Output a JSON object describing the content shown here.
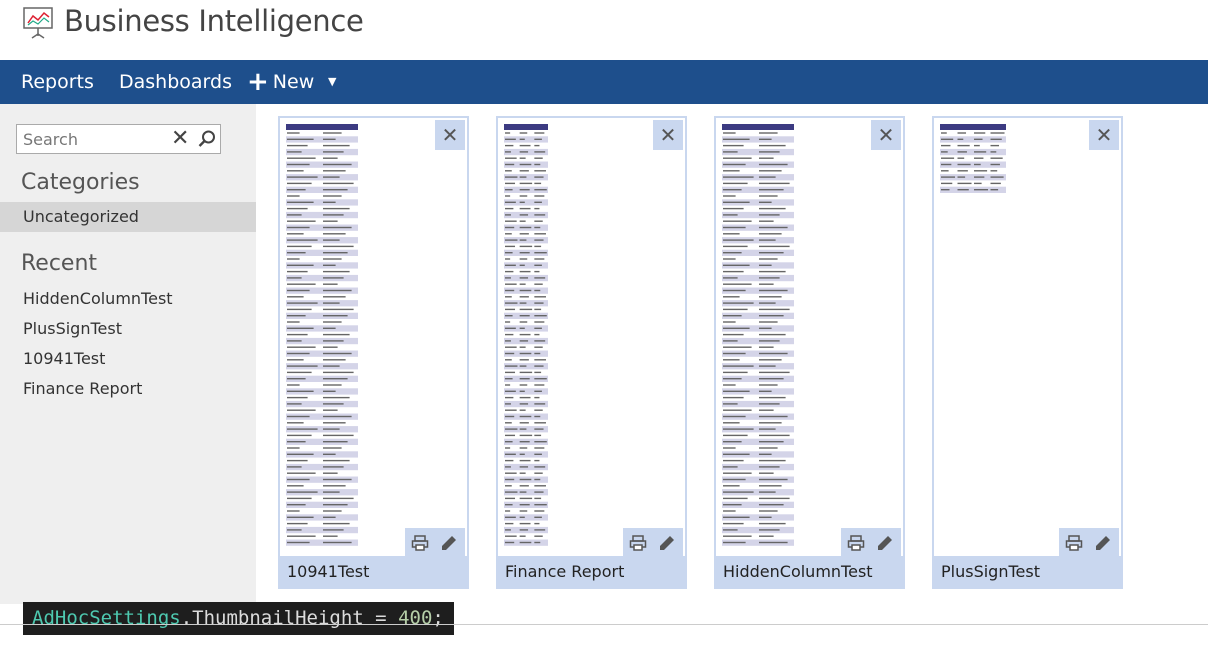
{
  "app": {
    "title": "Business Intelligence",
    "logo_icon": "presentation-board-icon"
  },
  "nav": {
    "reports": "Reports",
    "dashboards": "Dashboards",
    "new_label": "New",
    "new_icon": "plus-icon",
    "caret_icon": "caret-down-icon",
    "background": "#1e4f8c"
  },
  "sidebar": {
    "search_placeholder": "Search",
    "clear_glyph": "✕",
    "categories_title": "Categories",
    "categories": [
      "Uncategorized"
    ],
    "recent_title": "Recent",
    "recent": [
      "HiddenColumnTest",
      "PlusSignTest",
      "10941Test",
      "Finance Report"
    ]
  },
  "reports": [
    {
      "name": "10941Test",
      "thumb_cols": 2
    },
    {
      "name": "Finance Report",
      "thumb_cols": 3
    },
    {
      "name": "HiddenColumnTest",
      "thumb_cols": 2
    },
    {
      "name": "PlusSignTest",
      "thumb_cols": 4
    }
  ],
  "card": {
    "close_glyph": "✕",
    "accent": "#c9d7ef"
  },
  "code": {
    "type": "AdHocSettings",
    "member": ".ThumbnailHeight = ",
    "value": "400",
    "end": ";"
  }
}
